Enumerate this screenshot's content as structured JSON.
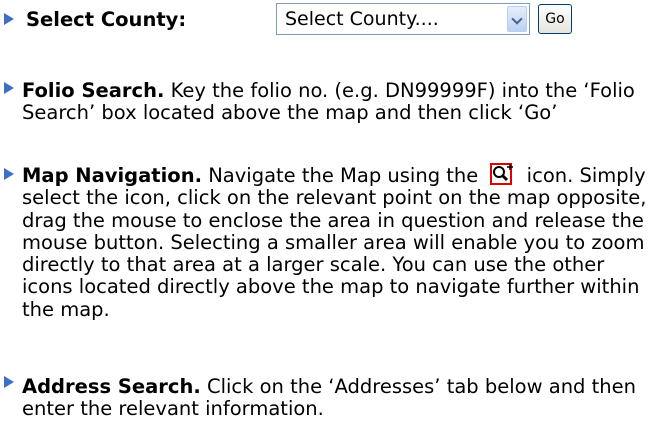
{
  "county": {
    "label": "Select County:",
    "select_value": "Select County....",
    "go_label": "Go"
  },
  "items": [
    {
      "title": "Folio Search.",
      "text": " Key the folio no. (e.g. DN99999F) into the ‘Folio Search’ box located above the map and then click ‘Go’"
    },
    {
      "title": "Map Navigation.",
      "text_before_icon": " Navigate the Map using the ",
      "icon": "zoom-in-icon",
      "text_after_icon": " icon. Simply select the icon, click on the relevant point on the map opposite, drag the mouse to enclose the area in question and release the mouse button. Selecting a smaller area will enable you to zoom directly to that area at a larger scale. You can use the other icons located directly above the map to navigate further within the map."
    },
    {
      "title": "Address Search.",
      "text": " Click on the ‘Addresses’ tab below and then enter the relevant information."
    }
  ],
  "colors": {
    "bullet": "#3f6fc0",
    "icon_border": "#e00000"
  }
}
